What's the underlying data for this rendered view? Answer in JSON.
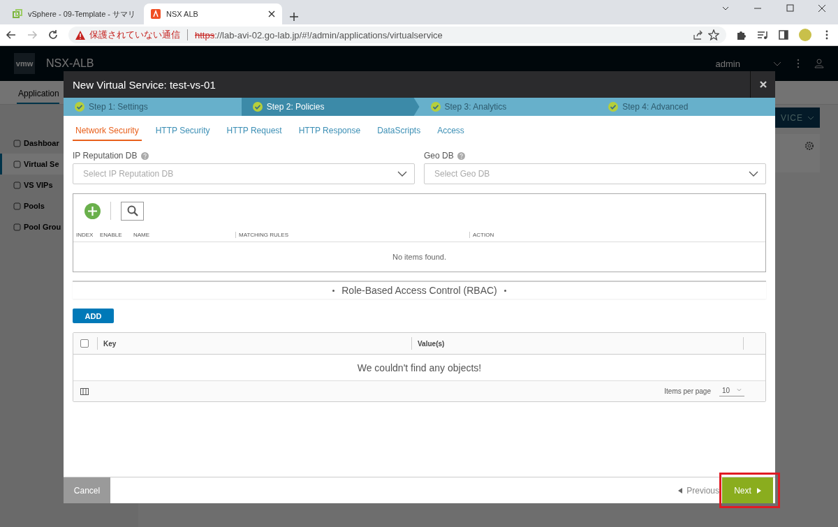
{
  "browser": {
    "tabs": [
      {
        "title": "vSphere - 09-Template - サマリ",
        "selected": false
      },
      {
        "title": "NSX ALB",
        "selected": true
      }
    ],
    "security_warning": "保護されていない通信",
    "url_scheme": "https",
    "url_rest": "://lab-avi-02.go-lab.jp/#!/admin/applications/virtualservice"
  },
  "app": {
    "logo": "vmw",
    "product": "NSX-ALB",
    "user": "admin",
    "nav_tab": "Application",
    "sidebar": [
      {
        "label": "Dashboar",
        "selected": false
      },
      {
        "label": "Virtual Se",
        "selected": true
      },
      {
        "label": "VS VIPs",
        "selected": false
      },
      {
        "label": "Pools",
        "selected": false
      },
      {
        "label": "Pool Grou",
        "selected": false
      }
    ],
    "create_button": "VICE"
  },
  "modal": {
    "title": "New Virtual Service: test-vs-01",
    "steps": [
      {
        "label": "Step 1: Settings",
        "selected": false
      },
      {
        "label": "Step 2: Policies",
        "selected": true
      },
      {
        "label": "Step 3: Analytics",
        "selected": false
      },
      {
        "label": "Step 4: Advanced",
        "selected": false
      }
    ],
    "tabs": [
      {
        "label": "Network Security",
        "selected": true
      },
      {
        "label": "HTTP Security",
        "selected": false
      },
      {
        "label": "HTTP Request",
        "selected": false
      },
      {
        "label": "HTTP Response",
        "selected": false
      },
      {
        "label": "DataScripts",
        "selected": false
      },
      {
        "label": "Access",
        "selected": false
      }
    ],
    "fields": [
      {
        "label": "IP Reputation DB",
        "placeholder": "Select IP Reputation DB"
      },
      {
        "label": "Geo DB",
        "placeholder": "Select Geo DB"
      }
    ],
    "rules_table": {
      "columns": [
        "INDEX",
        "ENABLE",
        "NAME",
        "MATCHING RULES",
        "ACTION"
      ],
      "empty_text": "No items found."
    },
    "rbac": {
      "heading": "Role-Based Access Control (RBAC)",
      "add_button": "ADD",
      "select_all_checked": false,
      "columns": [
        "Key",
        "Value(s)"
      ],
      "empty_text": "We couldn't find any objects!",
      "items_per_page_label": "Items per page",
      "items_per_page": "10"
    },
    "footer": {
      "cancel": "Cancel",
      "previous": "Previous",
      "next": "Next",
      "next_highlighted": true
    }
  }
}
